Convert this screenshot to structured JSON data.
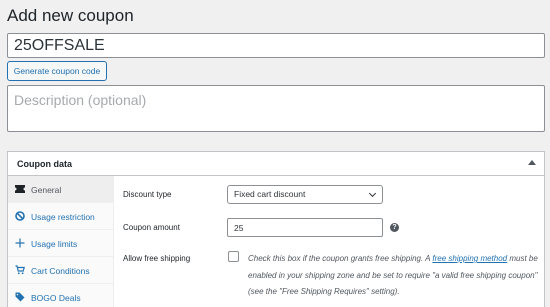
{
  "page": {
    "title": "Add new coupon"
  },
  "coupon": {
    "code": "25OFFSALE",
    "generate_label": "Generate coupon code",
    "description_placeholder": "Description (optional)"
  },
  "panel": {
    "title": "Coupon data",
    "tabs": [
      {
        "label": "General",
        "icon": "ticket-icon",
        "active": true
      },
      {
        "label": "Usage restriction",
        "icon": "block-icon"
      },
      {
        "label": "Usage limits",
        "icon": "plus-arrows-icon"
      },
      {
        "label": "Cart Conditions",
        "icon": "cart-icon"
      },
      {
        "label": "BOGO Deals",
        "icon": "tags-icon"
      }
    ],
    "fields": {
      "discount_type_label": "Discount type",
      "discount_type_value": "Fixed cart discount",
      "amount_label": "Coupon amount",
      "amount_value": "25",
      "help_glyph": "?",
      "free_shipping_label": "Allow free shipping",
      "free_shipping_text_1": "Check this box if the coupon grants free shipping. A ",
      "free_shipping_link": "free shipping method",
      "free_shipping_text_2": " must be enabled in your shipping zone and be set to require \"a valid free shipping coupon\" (see the \"Free Shipping Requires\" setting)."
    }
  },
  "colors": {
    "accent": "#2271b1",
    "background": "#f0f0f1"
  }
}
